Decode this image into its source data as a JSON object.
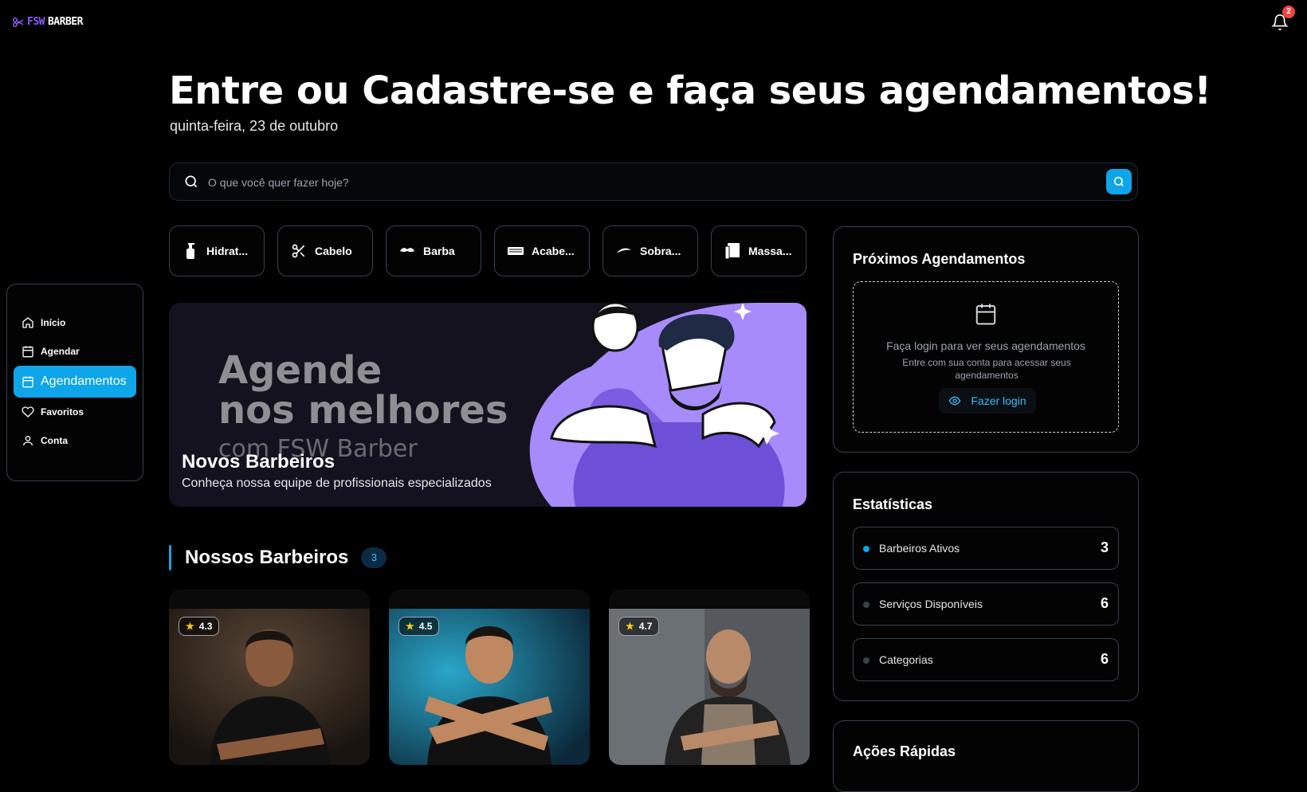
{
  "brand": {
    "logo_prefix": "FSW",
    "logo_suffix": "BARBER",
    "accent": "#8b5cf6"
  },
  "notifications": {
    "count": "2"
  },
  "hero": {
    "title": "Entre ou Cadastre-se e faça seus agendamentos!",
    "date": "quinta-feira, 23 de outubro"
  },
  "search": {
    "placeholder": "O que você quer fazer hoje?"
  },
  "categories": [
    {
      "label": "Hidrat...",
      "icon": "bottle-icon"
    },
    {
      "label": "Cabelo",
      "icon": "scissors-icon"
    },
    {
      "label": "Barba",
      "icon": "mustache-icon"
    },
    {
      "label": "Acabe...",
      "icon": "razor-icon"
    },
    {
      "label": "Sobra...",
      "icon": "eyebrow-icon"
    },
    {
      "label": "Massa...",
      "icon": "towel-icon"
    }
  ],
  "sidebar": {
    "items": [
      {
        "label": "Início",
        "icon": "home-icon"
      },
      {
        "label": "Agendar",
        "icon": "calendar-icon"
      },
      {
        "label": "Agendamentos",
        "icon": "calendar-icon",
        "active": true
      },
      {
        "label": "Favoritos",
        "icon": "heart-icon"
      },
      {
        "label": "Conta",
        "icon": "user-icon"
      }
    ]
  },
  "banner": {
    "bg_line1": "Agende",
    "bg_line2": "nos melhores",
    "bg_line3": "com FSW Barber",
    "title": "Novos Barbeiros",
    "subtitle": "Conheça nossa equipe de profissionais especializados"
  },
  "barbers_section": {
    "title": "Nossos Barbeiros",
    "count": "3"
  },
  "barbers": [
    {
      "rating": "4.3"
    },
    {
      "rating": "4.5"
    },
    {
      "rating": "4.7"
    }
  ],
  "appointments": {
    "title": "Próximos Agendamentos",
    "empty_title": "Faça login para ver seus agendamentos",
    "empty_sub": "Entre com sua conta para acessar seus agendamentos",
    "login_label": "Fazer login"
  },
  "stats": {
    "title": "Estatísticas",
    "rows": [
      {
        "label": "Barbeiros Ativos",
        "value": "3"
      },
      {
        "label": "Serviços Disponíveis",
        "value": "6"
      },
      {
        "label": "Categorias",
        "value": "6"
      }
    ]
  },
  "quick_actions": {
    "title": "Ações Rápidas"
  }
}
